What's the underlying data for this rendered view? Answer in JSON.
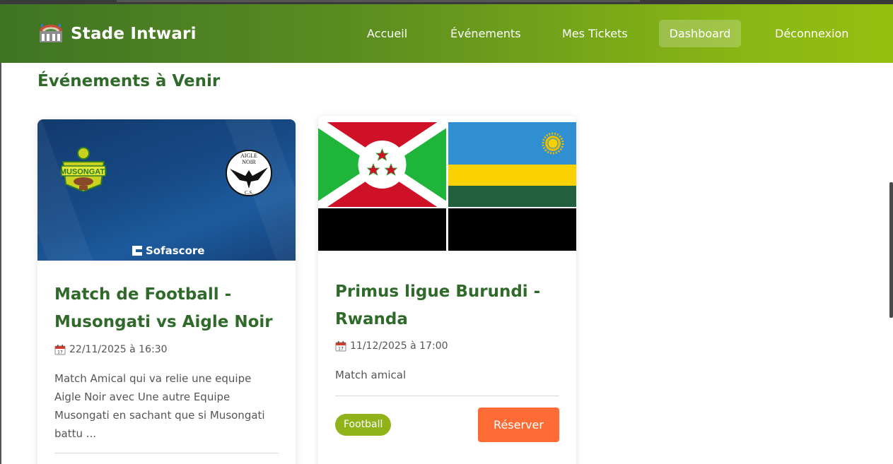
{
  "app": {
    "brand_name": "Stade Intwari",
    "brand_icon": "stadium-icon"
  },
  "nav": {
    "items": [
      {
        "label": "Accueil"
      },
      {
        "label": "Événements"
      },
      {
        "label": "Mes Tickets"
      },
      {
        "label": "Dashboard",
        "active": true
      },
      {
        "label": "Déconnexion"
      }
    ]
  },
  "main": {
    "section_title": "Événements à Venir",
    "events": [
      {
        "title": "Match de Football - Musongati vs Aigle Noir",
        "date": "22/11/2025 à 16:30",
        "description": "Match Amical qui va relie une equipe Aigle Noir avec Une autre Equipe Musongati en sachant que si Musongati battu ...",
        "image": {
          "team_left": "MUSONGATI",
          "team_right_line1": "AIGLE",
          "team_right_line2": "NOIR",
          "team_right_line3": "C.S.",
          "watermark": "Sofascore"
        }
      },
      {
        "title": "Primus ligue Burundi - Rwanda",
        "date": "11/12/2025 à 17:00",
        "description": "Match amical",
        "category": "Football",
        "reserve_label": "Réserver",
        "image": {
          "flags": [
            "burundi-flag-icon",
            "rwanda-flag-icon"
          ]
        }
      }
    ]
  },
  "colors": {
    "nav_gradient_start": "#3f7424",
    "nav_gradient_end": "#95bf10",
    "title_green": "#2f6a2a",
    "badge_green": "#8fb319",
    "reserve_orange": "#ff6b35"
  }
}
